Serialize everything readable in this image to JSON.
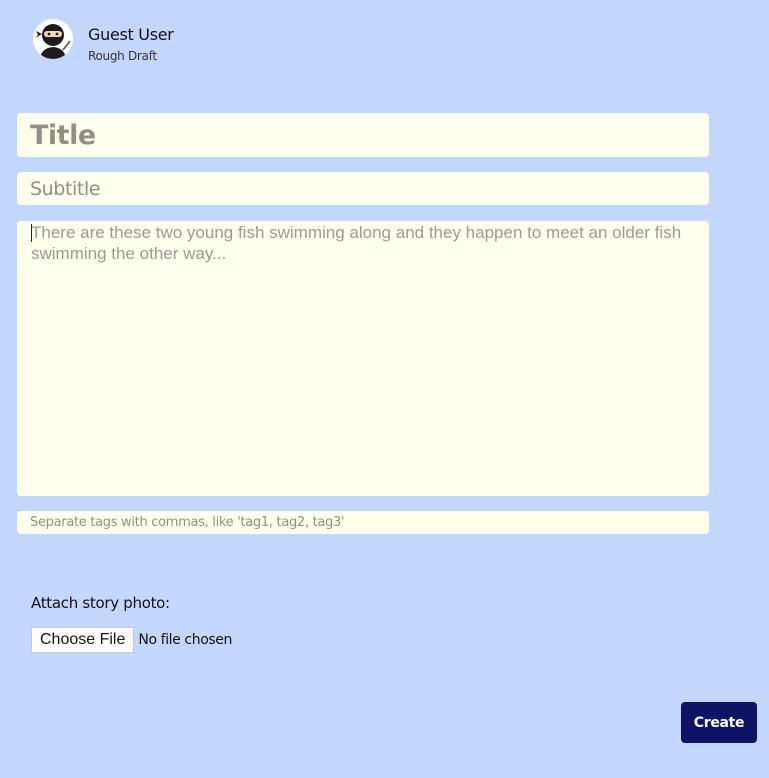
{
  "author": {
    "name": "Guest User",
    "status": "Rough Draft",
    "avatar_icon": "ninja-avatar-icon"
  },
  "form": {
    "title_placeholder": "Title",
    "subtitle_placeholder": "Subtitle",
    "body_placeholder": "There are these two young fish swimming along and they happen to meet an older fish swimming the other way...",
    "tags_placeholder": "Separate tags with commas, like 'tag1, tag2, tag3'",
    "attach_label": "Attach story photo:",
    "choose_file_label": "Choose File",
    "file_status": "No file chosen",
    "create_label": "Create"
  },
  "colors": {
    "background": "#c4d8ff",
    "field_background": "#ffffee",
    "create_button": "#0d1466"
  }
}
